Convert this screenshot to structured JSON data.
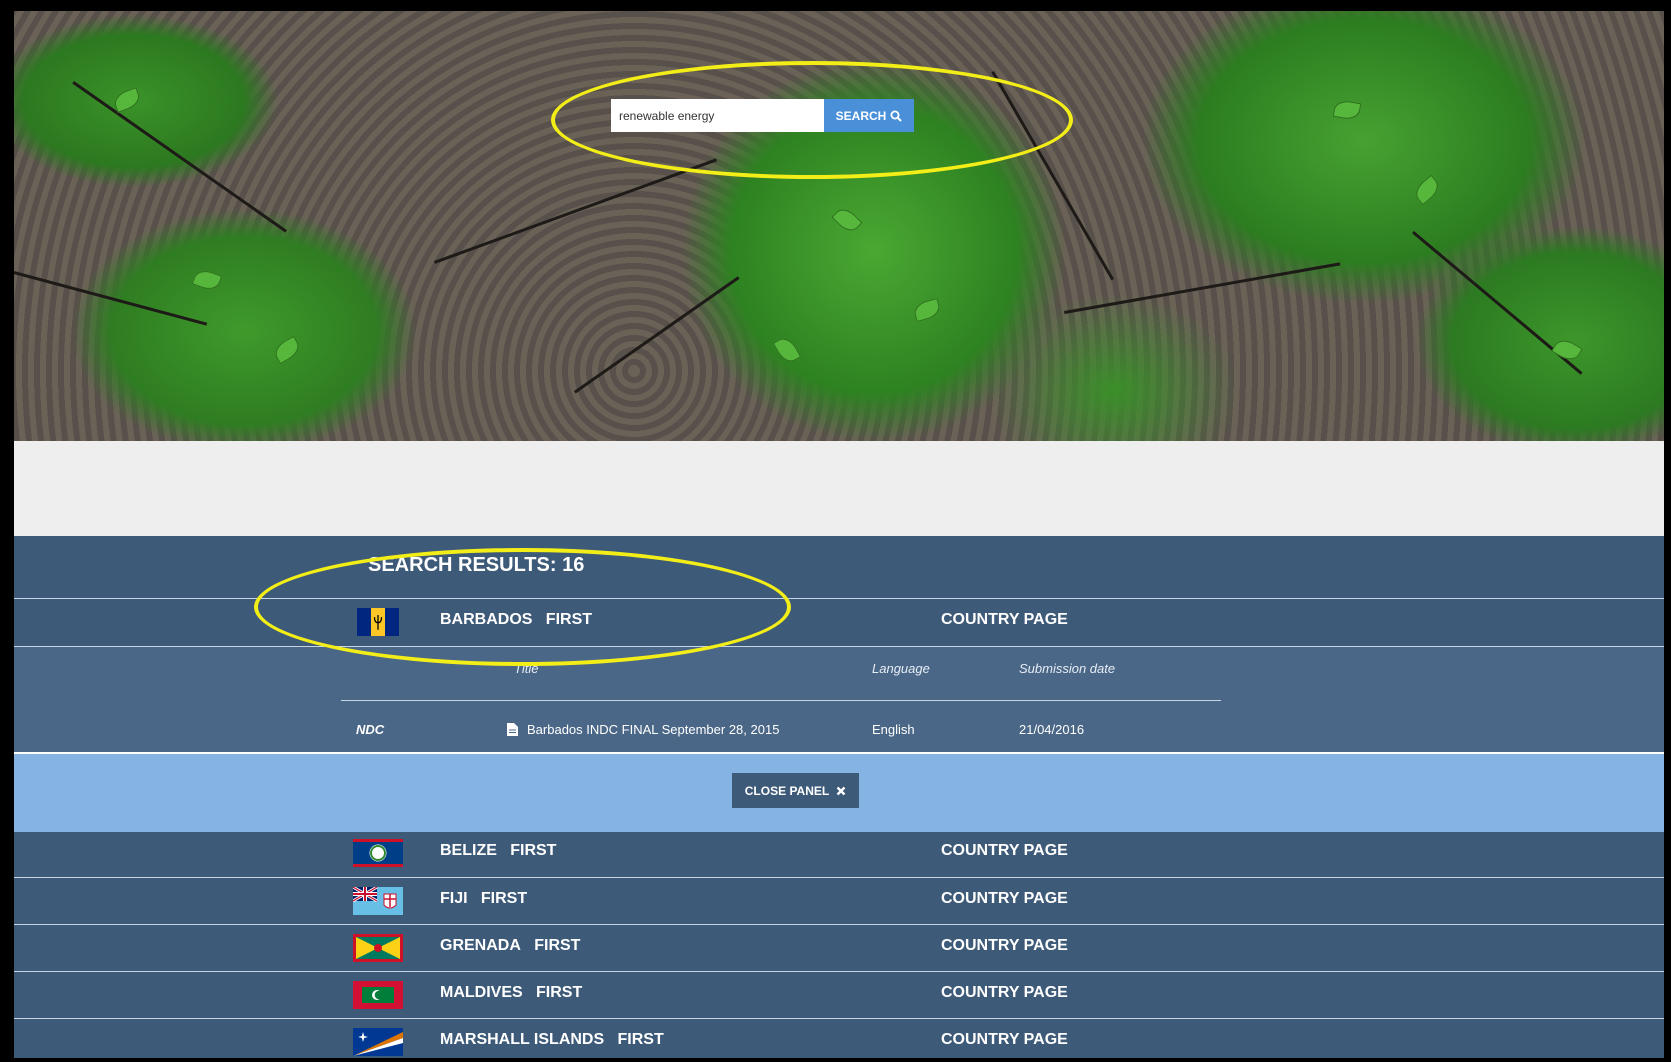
{
  "search": {
    "value": "renewable energy",
    "button_label": "SEARCH",
    "button_icon": "search-icon"
  },
  "results": {
    "title": "SEARCH RESULTS: 16",
    "country_page_label": "COUNTRY PAGE",
    "expanded": {
      "country": "BARBADOS",
      "ndc_order": "FIRST",
      "flag": "barbados-flag-icon",
      "columns": {
        "title": "Title",
        "language": "Language",
        "date": "Submission date"
      },
      "document": {
        "type": "NDC",
        "icon": "document-icon",
        "title": "Barbados INDC FINAL September 28, 2015",
        "language": "English",
        "date": "21/04/2016"
      },
      "close_label": "CLOSE PANEL",
      "close_icon": "close-icon"
    },
    "items": [
      {
        "country": "BELIZE",
        "ndc_order": "FIRST",
        "flag": "belize-flag-icon"
      },
      {
        "country": "FIJI",
        "ndc_order": "FIRST",
        "flag": "fiji-flag-icon"
      },
      {
        "country": "GRENADA",
        "ndc_order": "FIRST",
        "flag": "grenada-flag-icon"
      },
      {
        "country": "MALDIVES",
        "ndc_order": "FIRST",
        "flag": "maldives-flag-icon"
      },
      {
        "country": "MARSHALL ISLANDS",
        "ndc_order": "FIRST",
        "flag": "marshall-islands-flag-icon"
      }
    ]
  },
  "colors": {
    "highlight": "#f3ee17",
    "panel": "#3e5a79",
    "close_bar": "#84b3e4",
    "search_button": "#4a90d9"
  }
}
